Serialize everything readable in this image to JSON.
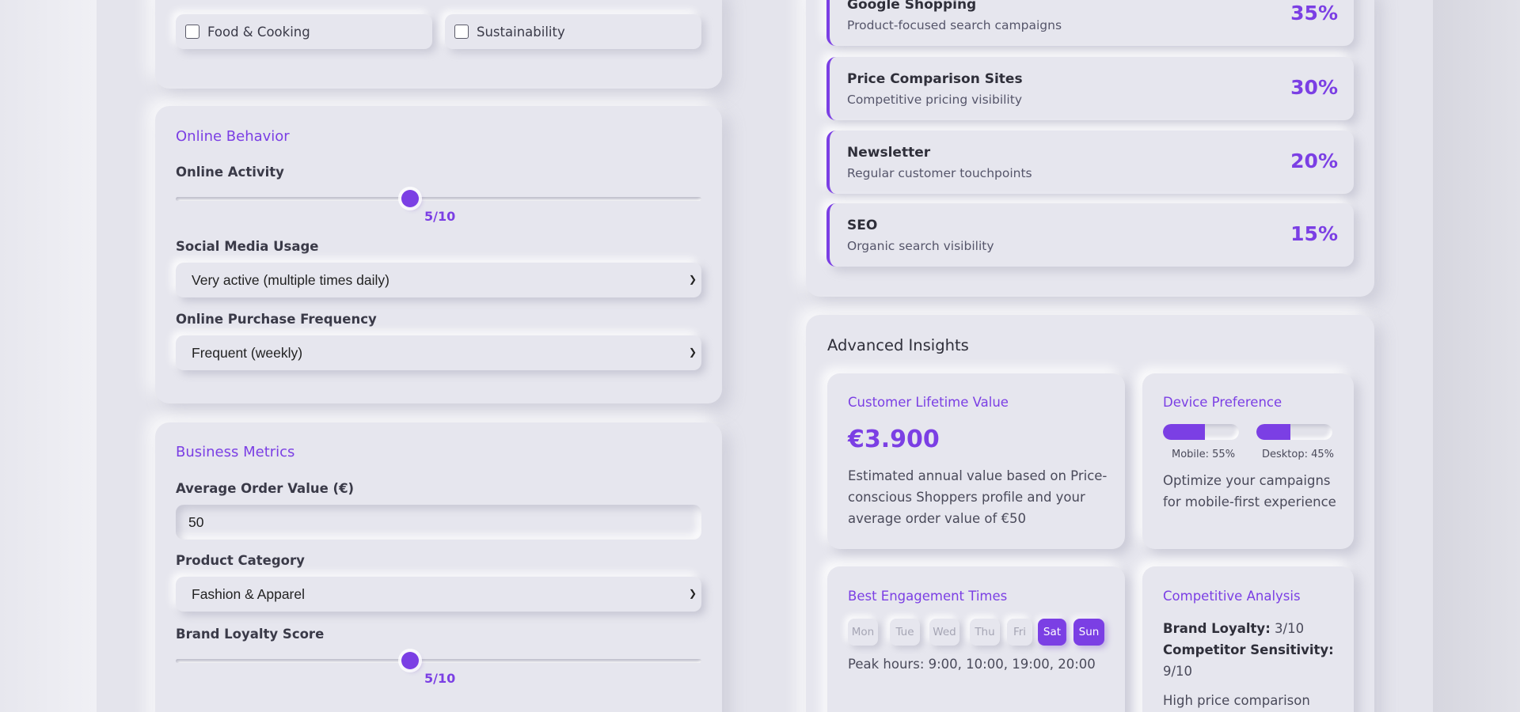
{
  "interests": [
    {
      "label": "Food & Cooking",
      "checked": false
    },
    {
      "label": "Sustainability",
      "checked": false
    }
  ],
  "online_behavior": {
    "title": "Online Behavior",
    "activity_label": "Online Activity",
    "activity_value": 5,
    "activity_display": "5/10",
    "social_label": "Social Media Usage",
    "social_value": "Very active (multiple times daily)",
    "purchase_label": "Online Purchase Frequency",
    "purchase_value": "Frequent (weekly)"
  },
  "business_metrics": {
    "title": "Business Metrics",
    "aov_label": "Average Order Value (€)",
    "aov_value": "50",
    "category_label": "Product Category",
    "category_value": "Fashion & Apparel",
    "loyalty_label": "Brand Loyalty Score",
    "loyalty_value": 5,
    "loyalty_display": "5/10"
  },
  "channels": [
    {
      "name": "Google Shopping",
      "desc": "Product-focused search campaigns",
      "pct": "35%"
    },
    {
      "name": "Price Comparison Sites",
      "desc": "Competitive pricing visibility",
      "pct": "30%"
    },
    {
      "name": "Newsletter",
      "desc": "Regular customer touchpoints",
      "pct": "20%"
    },
    {
      "name": "SEO",
      "desc": "Organic search visibility",
      "pct": "15%"
    }
  ],
  "insights": {
    "title": "Advanced Insights",
    "clv": {
      "title": "Customer Lifetime Value",
      "value": "€3.900",
      "line1": "Estimated annual value based on Price-",
      "line2": "conscious Shoppers profile and your",
      "line3": "average order value of €50"
    },
    "device": {
      "title": "Device Preference",
      "mobile_pct": 55,
      "desktop_pct": 45,
      "mobile_label": "Mobile: 55%",
      "desktop_label": "Desktop: 45%",
      "line1": "Optimize your campaigns",
      "line2": "for mobile-first experience"
    },
    "engagement": {
      "title": "Best Engagement Times",
      "days": [
        {
          "label": "Mon",
          "active": false
        },
        {
          "label": "Tue",
          "active": false
        },
        {
          "label": "Wed",
          "active": false
        },
        {
          "label": "Thu",
          "active": false
        },
        {
          "label": "Fri",
          "active": false
        },
        {
          "label": "Sat",
          "active": true
        },
        {
          "label": "Sun",
          "active": true
        }
      ],
      "peak": "Peak hours: 9:00, 10:00, 19:00, 20:00"
    },
    "competitive": {
      "title": "Competitive Analysis",
      "loyalty_key": "Brand Loyalty:",
      "loyalty_val": "3/10",
      "sensitivity_key": "Competitor Sensitivity:",
      "sensitivity_val": "9/10",
      "note": "High price comparison"
    }
  },
  "colors": {
    "accent": "#7b3fe4",
    "background": "#e4e4ec"
  }
}
